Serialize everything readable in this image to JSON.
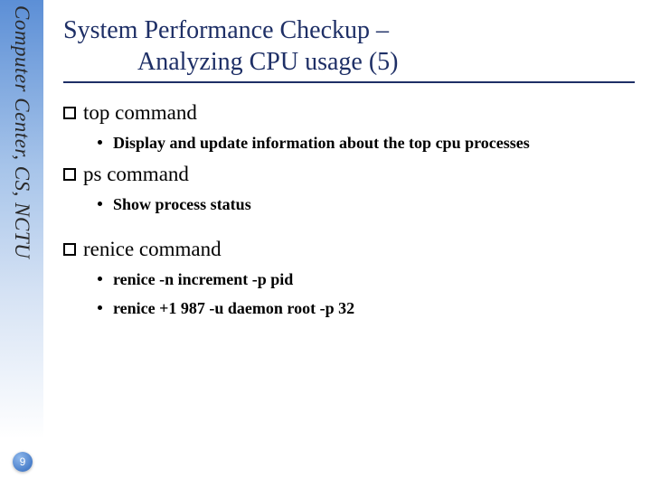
{
  "sidebar": {
    "label": "Computer Center, CS, NCTU"
  },
  "page_number": "9",
  "title": {
    "line1": "System Performance Checkup –",
    "line2": "Analyzing CPU usage (5)"
  },
  "sections": [
    {
      "heading": "top command",
      "items": [
        "Display and update information about the top cpu processes"
      ]
    },
    {
      "heading": "ps command",
      "items": [
        "Show process status"
      ]
    },
    {
      "heading": "renice command",
      "items": [
        "renice -n increment -p pid",
        "renice +1 987 -u daemon root -p 32"
      ]
    }
  ]
}
